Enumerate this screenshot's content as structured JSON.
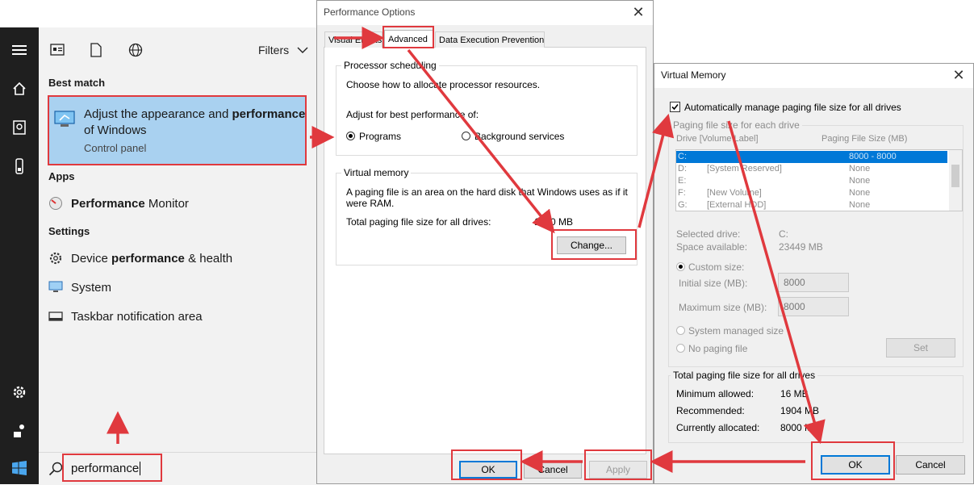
{
  "start_menu": {
    "filters_label": "Filters",
    "best_match_heading": "Best match",
    "best_match": {
      "title_prefix": "Adjust the appearance and ",
      "title_bold": "performance",
      "title_suffix": "of Windows",
      "subtitle": "Control panel"
    },
    "apps_heading": "Apps",
    "apps": [
      {
        "bold": "Performance",
        "rest": " Monitor"
      }
    ],
    "settings_heading": "Settings",
    "settings": [
      {
        "prefix": "Device ",
        "bold": "performance",
        "rest": " & health"
      },
      {
        "label": "System"
      },
      {
        "label": "Taskbar notification area"
      }
    ],
    "search_value": "performance"
  },
  "perf_options": {
    "title": "Performance Options",
    "tabs": [
      "Visual Effects",
      "Advanced",
      "Data Execution Prevention"
    ],
    "processor_group": "Processor scheduling",
    "processor_desc": "Choose how to allocate processor resources.",
    "adjust_label": "Adjust for best performance of:",
    "radio_programs": "Programs",
    "radio_background": "Background services",
    "vm_group": "Virtual memory",
    "vm_desc": "A paging file is an area on the hard disk that Windows uses as if it were RAM.",
    "vm_total_label": "Total paging file size for all drives:",
    "vm_total_value": "1280 MB",
    "change_button": "Change...",
    "ok_button": "OK",
    "cancel_button": "Cancel",
    "apply_button": "Apply"
  },
  "virtual_memory": {
    "title": "Virtual Memory",
    "auto_manage_label": "Automatically manage paging file size for all drives",
    "auto_manage_checked": true,
    "paging_group": "Paging file size for each drive",
    "col_drive": "Drive [Volume Label]",
    "col_size": "Paging File Size (MB)",
    "drives": [
      {
        "drive": "C:",
        "label": "",
        "size": "8000 - 8000"
      },
      {
        "drive": "D:",
        "label": "[System Reserved]",
        "size": "None"
      },
      {
        "drive": "E:",
        "label": "",
        "size": "None"
      },
      {
        "drive": "F:",
        "label": "[New Volume]",
        "size": "None"
      },
      {
        "drive": "G:",
        "label": "[External HDD]",
        "size": "None"
      }
    ],
    "selected_drive_label": "Selected drive:",
    "selected_drive_value": "C:",
    "space_available_label": "Space available:",
    "space_available_value": "23449 MB",
    "custom_size_label": "Custom size:",
    "initial_size_label": "Initial size (MB):",
    "initial_size_value": "8000",
    "max_size_label": "Maximum size (MB):",
    "max_size_value": "8000",
    "system_managed_label": "System managed size",
    "no_paging_label": "No paging file",
    "set_button": "Set",
    "total_group": "Total paging file size for all drives",
    "min_allowed_label": "Minimum allowed:",
    "min_allowed_value": "16 MB",
    "recommended_label": "Recommended:",
    "recommended_value": "1904 MB",
    "current_label": "Currently allocated:",
    "current_value": "8000 MB",
    "ok_button": "OK",
    "cancel_button": "Cancel"
  },
  "colors": {
    "annotation": "#e0393e",
    "highlight": "#a9d1f0",
    "accent": "#0078d7"
  }
}
